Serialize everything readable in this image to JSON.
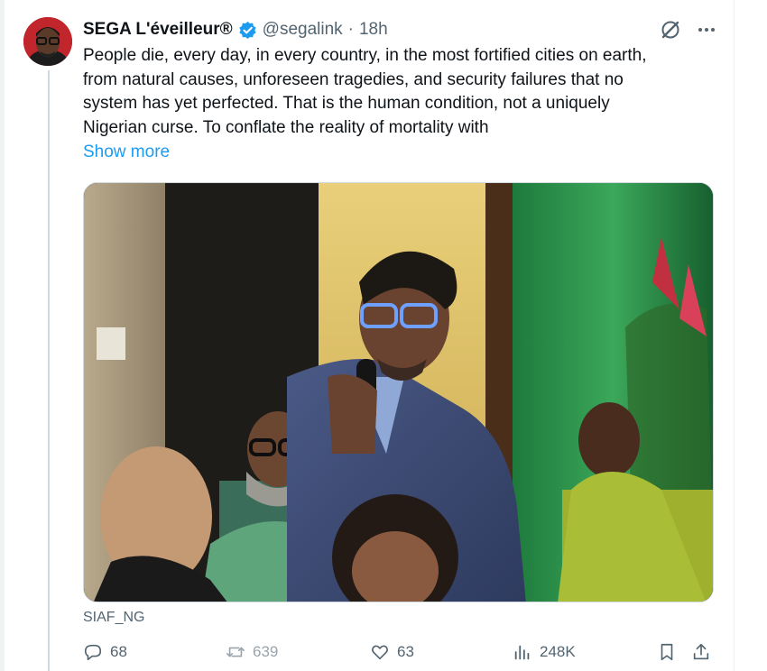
{
  "tweet": {
    "author": {
      "display_name": "SEGA L'éveilleur®",
      "handle": "@segalink",
      "verified_icon": "verified-badge-icon",
      "avatar_icon": "avatar"
    },
    "separator": "·",
    "time": "18h",
    "text_lines": [
      "People die, every day, in every country, in the most fortified cities on earth,",
      "from natural causes, unforeseen tragedies, and security failures that no",
      "system has yet perfected. That is the human condition, not a uniquely",
      "Nigerian curse. To conflate the reality of mortality with"
    ],
    "show_more": "Show more",
    "media_source": "SIAF_NG",
    "actions": {
      "replies": "68",
      "reposts": "639",
      "likes": "63",
      "views": "248K"
    }
  },
  "colors": {
    "link": "#1d9bf0",
    "muted": "#536471",
    "text": "#0f1419",
    "verified": "#1d9bf0"
  },
  "icons": {
    "grok": "grok-icon",
    "more": "more-icon",
    "reply": "reply-icon",
    "repost": "repost-icon",
    "like": "like-icon",
    "views": "views-icon",
    "bookmark": "bookmark-icon",
    "share": "share-icon"
  }
}
